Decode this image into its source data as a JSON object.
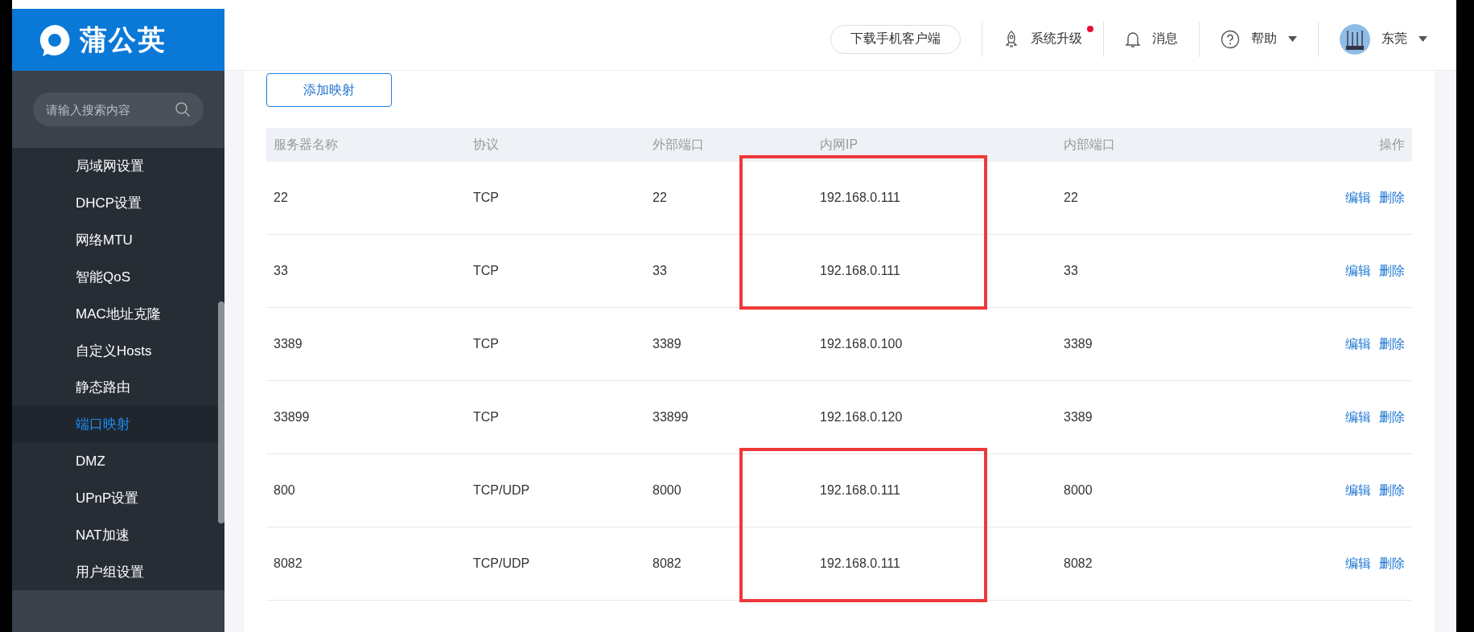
{
  "logo": {
    "text": "蒲公英"
  },
  "search": {
    "placeholder": "请输入搜索内容"
  },
  "sidebar": {
    "items": [
      {
        "label": "局域网设置",
        "selected": false
      },
      {
        "label": "DHCP设置",
        "selected": false
      },
      {
        "label": "网络MTU",
        "selected": false
      },
      {
        "label": "智能QoS",
        "selected": false
      },
      {
        "label": "MAC地址克隆",
        "selected": false
      },
      {
        "label": "自定义Hosts",
        "selected": false
      },
      {
        "label": "静态路由",
        "selected": false
      },
      {
        "label": "端口映射",
        "selected": true
      },
      {
        "label": "DMZ",
        "selected": false
      },
      {
        "label": "UPnP设置",
        "selected": false
      },
      {
        "label": "NAT加速",
        "selected": false
      },
      {
        "label": "用户组设置",
        "selected": false
      }
    ]
  },
  "header": {
    "download_button": "下载手机客户端",
    "upgrade": {
      "label": "系统升级",
      "has_notice": true
    },
    "messages": "消息",
    "help": "帮助",
    "device": "东莞"
  },
  "add_button": "添加映射",
  "table": {
    "columns": [
      "服务器名称",
      "协议",
      "外部端口",
      "内网IP",
      "内部端口",
      "操作"
    ],
    "rows": [
      {
        "cells": [
          "22",
          "TCP",
          "22",
          "192.168.0.111",
          "22"
        ],
        "actions": [
          "编辑",
          "删除"
        ],
        "highlighted": true
      },
      {
        "cells": [
          "33",
          "TCP",
          "33",
          "192.168.0.111",
          "33"
        ],
        "actions": [
          "编辑",
          "删除"
        ],
        "highlighted": true
      },
      {
        "cells": [
          "3389",
          "TCP",
          "3389",
          "192.168.0.100",
          "3389"
        ],
        "actions": [
          "编辑",
          "删除"
        ],
        "highlighted": false
      },
      {
        "cells": [
          "33899",
          "TCP",
          "33899",
          "192.168.0.120",
          "3389"
        ],
        "actions": [
          "编辑",
          "删除"
        ],
        "highlighted": false
      },
      {
        "cells": [
          "800",
          "TCP/UDP",
          "8000",
          "192.168.0.111",
          "8000"
        ],
        "actions": [
          "编辑",
          "删除"
        ],
        "highlighted": true
      },
      {
        "cells": [
          "8082",
          "TCP/UDP",
          "8082",
          "192.168.0.111",
          "8082"
        ],
        "actions": [
          "编辑",
          "删除"
        ],
        "highlighted": true
      }
    ]
  }
}
